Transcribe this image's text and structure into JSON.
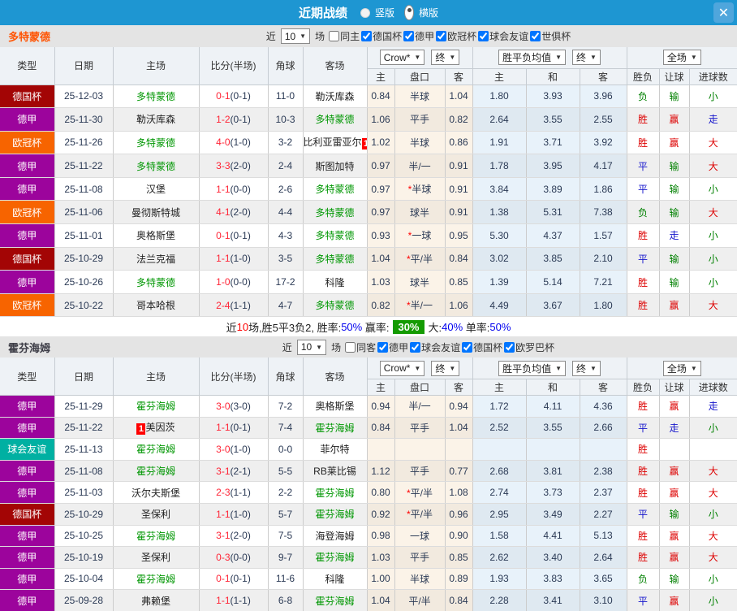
{
  "titlebar": {
    "title": "近期战绩",
    "radio_vertical": "竖版",
    "radio_horizontal": "横版",
    "close": "✕"
  },
  "colors": {
    "bar_blue": "#1e96d2",
    "score_red": "#ff2436",
    "team_green": "#009703",
    "result_red": "#dd0000",
    "result_green": "#008000",
    "result_blue": "#1515cc",
    "rate_blue": "#0000ee",
    "profit_box_green": "#149b02",
    "dortmund_orange": "#ff5505"
  },
  "league_colors": {
    "德国杯": "#a30505",
    "德甲": "#9c049c",
    "欧冠杯": "#f76400",
    "球会友谊": "#00b0a2"
  },
  "sections": [
    {
      "team": "多特蒙德",
      "filter": {
        "near": "近",
        "count": "10",
        "matches": "场",
        "same": {
          "label": "同主",
          "checked": false
        },
        "leagues": [
          {
            "label": "德国杯",
            "checked": true
          },
          {
            "label": "德甲",
            "checked": true
          },
          {
            "label": "欧冠杯",
            "checked": true
          },
          {
            "label": "球会友谊",
            "checked": true
          },
          {
            "label": "世俱杯",
            "checked": true
          }
        ]
      },
      "header": {
        "type": "类型",
        "date": "日期",
        "home": "主场",
        "score": "比分(半场)",
        "corner": "角球",
        "away": "客场",
        "odds_source": "Crow*",
        "odds_final": "终",
        "avg_source": "胜平负均值",
        "avg_final": "终",
        "scope": "全场",
        "odds_home": "主",
        "odds_handicap": "盘口",
        "odds_away": "客",
        "avg_home": "主",
        "avg_draw": "和",
        "avg_away": "客",
        "result": "胜负",
        "handicap_result": "让球",
        "goals_result": "进球数"
      },
      "rows": [
        {
          "league": "德国杯",
          "date": "25-12-03",
          "home": {
            "name": "多特蒙德",
            "green": true
          },
          "score": "0-1",
          "half": "0-1",
          "corner": "11-0",
          "away": {
            "name": "勒沃库森",
            "green": false
          },
          "odds": [
            "0.84",
            "半球",
            "1.04"
          ],
          "handicap_star": false,
          "avg": [
            "1.80",
            "3.93",
            "3.96"
          ],
          "results": [
            {
              "t": "负",
              "c": "green"
            },
            {
              "t": "输",
              "c": "green"
            },
            {
              "t": "小",
              "c": "green"
            }
          ]
        },
        {
          "league": "德甲",
          "date": "25-11-30",
          "home": {
            "name": "勒沃库森",
            "green": false
          },
          "score": "1-2",
          "half": "0-1",
          "corner": "10-3",
          "away": {
            "name": "多特蒙德",
            "green": true
          },
          "odds": [
            "1.06",
            "平手",
            "0.82"
          ],
          "handicap_star": false,
          "avg": [
            "2.64",
            "3.55",
            "2.55"
          ],
          "results": [
            {
              "t": "胜",
              "c": "red"
            },
            {
              "t": "赢",
              "c": "red"
            },
            {
              "t": "走",
              "c": "blue"
            }
          ]
        },
        {
          "league": "欧冠杯",
          "date": "25-11-26",
          "home": {
            "name": "多特蒙德",
            "green": true
          },
          "score": "4-0",
          "half": "1-0",
          "corner": "3-2",
          "away": {
            "name": "比利亚雷亚尔",
            "green": false,
            "badge": "1"
          },
          "odds": [
            "1.02",
            "半球",
            "0.86"
          ],
          "handicap_star": false,
          "avg": [
            "1.91",
            "3.71",
            "3.92"
          ],
          "results": [
            {
              "t": "胜",
              "c": "red"
            },
            {
              "t": "赢",
              "c": "red"
            },
            {
              "t": "大",
              "c": "red"
            }
          ]
        },
        {
          "league": "德甲",
          "date": "25-11-22",
          "home": {
            "name": "多特蒙德",
            "green": true
          },
          "score": "3-3",
          "half": "2-0",
          "corner": "2-4",
          "away": {
            "name": "斯图加特",
            "green": false
          },
          "odds": [
            "0.97",
            "半/一",
            "0.91"
          ],
          "handicap_star": false,
          "avg": [
            "1.78",
            "3.95",
            "4.17"
          ],
          "results": [
            {
              "t": "平",
              "c": "blue"
            },
            {
              "t": "输",
              "c": "green"
            },
            {
              "t": "大",
              "c": "red"
            }
          ]
        },
        {
          "league": "德甲",
          "date": "25-11-08",
          "home": {
            "name": "汉堡",
            "green": false
          },
          "score": "1-1",
          "half": "0-0",
          "corner": "2-6",
          "away": {
            "name": "多特蒙德",
            "green": true
          },
          "odds": [
            "0.97",
            "半球",
            "0.91"
          ],
          "handicap_star": true,
          "avg": [
            "3.84",
            "3.89",
            "1.86"
          ],
          "results": [
            {
              "t": "平",
              "c": "blue"
            },
            {
              "t": "输",
              "c": "green"
            },
            {
              "t": "小",
              "c": "green"
            }
          ]
        },
        {
          "league": "欧冠杯",
          "date": "25-11-06",
          "home": {
            "name": "曼彻斯特城",
            "green": false
          },
          "score": "4-1",
          "half": "2-0",
          "corner": "4-4",
          "away": {
            "name": "多特蒙德",
            "green": true
          },
          "odds": [
            "0.97",
            "球半",
            "0.91"
          ],
          "handicap_star": false,
          "avg": [
            "1.38",
            "5.31",
            "7.38"
          ],
          "results": [
            {
              "t": "负",
              "c": "green"
            },
            {
              "t": "输",
              "c": "green"
            },
            {
              "t": "大",
              "c": "red"
            }
          ]
        },
        {
          "league": "德甲",
          "date": "25-11-01",
          "home": {
            "name": "奥格斯堡",
            "green": false
          },
          "score": "0-1",
          "half": "0-1",
          "corner": "4-3",
          "away": {
            "name": "多特蒙德",
            "green": true
          },
          "odds": [
            "0.93",
            "一球",
            "0.95"
          ],
          "handicap_star": true,
          "avg": [
            "5.30",
            "4.37",
            "1.57"
          ],
          "results": [
            {
              "t": "胜",
              "c": "red"
            },
            {
              "t": "走",
              "c": "blue"
            },
            {
              "t": "小",
              "c": "green"
            }
          ]
        },
        {
          "league": "德国杯",
          "date": "25-10-29",
          "home": {
            "name": "法兰克福",
            "green": false
          },
          "score": "1-1",
          "half": "1-0",
          "corner": "3-5",
          "away": {
            "name": "多特蒙德",
            "green": true
          },
          "odds": [
            "1.04",
            "平/半",
            "0.84"
          ],
          "handicap_star": true,
          "avg": [
            "3.02",
            "3.85",
            "2.10"
          ],
          "results": [
            {
              "t": "平",
              "c": "blue"
            },
            {
              "t": "输",
              "c": "green"
            },
            {
              "t": "小",
              "c": "green"
            }
          ]
        },
        {
          "league": "德甲",
          "date": "25-10-26",
          "home": {
            "name": "多特蒙德",
            "green": true
          },
          "score": "1-0",
          "half": "0-0",
          "corner": "17-2",
          "away": {
            "name": "科隆",
            "green": false
          },
          "odds": [
            "1.03",
            "球半",
            "0.85"
          ],
          "handicap_star": false,
          "avg": [
            "1.39",
            "5.14",
            "7.21"
          ],
          "results": [
            {
              "t": "胜",
              "c": "red"
            },
            {
              "t": "输",
              "c": "green"
            },
            {
              "t": "小",
              "c": "green"
            }
          ]
        },
        {
          "league": "欧冠杯",
          "date": "25-10-22",
          "home": {
            "name": "哥本哈根",
            "green": false
          },
          "score": "2-4",
          "half": "1-1",
          "corner": "4-7",
          "away": {
            "name": "多特蒙德",
            "green": true
          },
          "odds": [
            "0.82",
            "半/一",
            "1.06"
          ],
          "handicap_star": true,
          "avg": [
            "4.49",
            "3.67",
            "1.80"
          ],
          "results": [
            {
              "t": "胜",
              "c": "red"
            },
            {
              "t": "赢",
              "c": "red"
            },
            {
              "t": "大",
              "c": "red"
            }
          ]
        }
      ],
      "summary": {
        "near": "近",
        "count": "10",
        "record": "场,胜5平3负2, 胜率:",
        "win_rate": "50%",
        "profit_label": " 赢率:",
        "profit_rate": "30%",
        "big_label": "大:",
        "big_rate": "40%",
        "single_label": " 单率:",
        "single_rate": "50%"
      }
    },
    {
      "team": "霍芬海姆",
      "filter": {
        "near": "近",
        "count": "10",
        "matches": "场",
        "same": {
          "label": "同客",
          "checked": false
        },
        "leagues": [
          {
            "label": "德甲",
            "checked": true
          },
          {
            "label": "球会友谊",
            "checked": true
          },
          {
            "label": "德国杯",
            "checked": true
          },
          {
            "label": "欧罗巴杯",
            "checked": true
          }
        ]
      },
      "header": {
        "type": "类型",
        "date": "日期",
        "home": "主场",
        "score": "比分(半场)",
        "corner": "角球",
        "away": "客场",
        "odds_source": "Crow*",
        "odds_final": "终",
        "avg_source": "胜平负均值",
        "avg_final": "终",
        "scope": "全场",
        "odds_home": "主",
        "odds_handicap": "盘口",
        "odds_away": "客",
        "avg_home": "主",
        "avg_draw": "和",
        "avg_away": "客",
        "result": "胜负",
        "handicap_result": "让球",
        "goals_result": "进球数"
      },
      "rows": [
        {
          "league": "德甲",
          "date": "25-11-29",
          "home": {
            "name": "霍芬海姆",
            "green": true
          },
          "score": "3-0",
          "half": "3-0",
          "corner": "7-2",
          "away": {
            "name": "奥格斯堡",
            "green": false
          },
          "odds": [
            "0.94",
            "半/一",
            "0.94"
          ],
          "handicap_star": false,
          "avg": [
            "1.72",
            "4.11",
            "4.36"
          ],
          "results": [
            {
              "t": "胜",
              "c": "red"
            },
            {
              "t": "赢",
              "c": "red"
            },
            {
              "t": "走",
              "c": "blue"
            }
          ]
        },
        {
          "league": "德甲",
          "date": "25-11-22",
          "home": {
            "name": "美因茨",
            "green": false,
            "badge": "1"
          },
          "score": "1-1",
          "half": "0-1",
          "corner": "7-4",
          "away": {
            "name": "霍芬海姆",
            "green": true
          },
          "odds": [
            "0.84",
            "平手",
            "1.04"
          ],
          "handicap_star": false,
          "avg": [
            "2.52",
            "3.55",
            "2.66"
          ],
          "results": [
            {
              "t": "平",
              "c": "blue"
            },
            {
              "t": "走",
              "c": "blue"
            },
            {
              "t": "小",
              "c": "green"
            }
          ]
        },
        {
          "league": "球会友谊",
          "date": "25-11-13",
          "home": {
            "name": "霍芬海姆",
            "green": true
          },
          "score": "3-0",
          "half": "1-0",
          "corner": "0-0",
          "away": {
            "name": "菲尔特",
            "green": false
          },
          "odds": [
            "",
            "",
            ""
          ],
          "handicap_star": false,
          "avg": [
            "",
            "",
            ""
          ],
          "results": [
            {
              "t": "胜",
              "c": "red"
            },
            {
              "t": "",
              "c": ""
            },
            {
              "t": "",
              "c": ""
            }
          ]
        },
        {
          "league": "德甲",
          "date": "25-11-08",
          "home": {
            "name": "霍芬海姆",
            "green": true
          },
          "score": "3-1",
          "half": "2-1",
          "corner": "5-5",
          "away": {
            "name": "RB莱比锡",
            "green": false
          },
          "odds": [
            "1.12",
            "平手",
            "0.77"
          ],
          "handicap_star": false,
          "avg": [
            "2.68",
            "3.81",
            "2.38"
          ],
          "results": [
            {
              "t": "胜",
              "c": "red"
            },
            {
              "t": "赢",
              "c": "red"
            },
            {
              "t": "大",
              "c": "red"
            }
          ]
        },
        {
          "league": "德甲",
          "date": "25-11-03",
          "home": {
            "name": "沃尔夫斯堡",
            "green": false
          },
          "score": "2-3",
          "half": "1-1",
          "corner": "2-2",
          "away": {
            "name": "霍芬海姆",
            "green": true
          },
          "odds": [
            "0.80",
            "平/半",
            "1.08"
          ],
          "handicap_star": true,
          "avg": [
            "2.74",
            "3.73",
            "2.37"
          ],
          "results": [
            {
              "t": "胜",
              "c": "red"
            },
            {
              "t": "赢",
              "c": "red"
            },
            {
              "t": "大",
              "c": "red"
            }
          ]
        },
        {
          "league": "德国杯",
          "date": "25-10-29",
          "home": {
            "name": "圣保利",
            "green": false
          },
          "score": "1-1",
          "half": "1-0",
          "corner": "5-7",
          "away": {
            "name": "霍芬海姆",
            "green": true
          },
          "odds": [
            "0.92",
            "平/半",
            "0.96"
          ],
          "handicap_star": true,
          "avg": [
            "2.95",
            "3.49",
            "2.27"
          ],
          "results": [
            {
              "t": "平",
              "c": "blue"
            },
            {
              "t": "输",
              "c": "green"
            },
            {
              "t": "小",
              "c": "green"
            }
          ]
        },
        {
          "league": "德甲",
          "date": "25-10-25",
          "home": {
            "name": "霍芬海姆",
            "green": true
          },
          "score": "3-1",
          "half": "2-0",
          "corner": "7-5",
          "away": {
            "name": "海登海姆",
            "green": false
          },
          "odds": [
            "0.98",
            "一球",
            "0.90"
          ],
          "handicap_star": false,
          "avg": [
            "1.58",
            "4.41",
            "5.13"
          ],
          "results": [
            {
              "t": "胜",
              "c": "red"
            },
            {
              "t": "赢",
              "c": "red"
            },
            {
              "t": "大",
              "c": "red"
            }
          ]
        },
        {
          "league": "德甲",
          "date": "25-10-19",
          "home": {
            "name": "圣保利",
            "green": false
          },
          "score": "0-3",
          "half": "0-0",
          "corner": "9-7",
          "away": {
            "name": "霍芬海姆",
            "green": true
          },
          "odds": [
            "1.03",
            "平手",
            "0.85"
          ],
          "handicap_star": false,
          "avg": [
            "2.62",
            "3.40",
            "2.64"
          ],
          "results": [
            {
              "t": "胜",
              "c": "red"
            },
            {
              "t": "赢",
              "c": "red"
            },
            {
              "t": "大",
              "c": "red"
            }
          ]
        },
        {
          "league": "德甲",
          "date": "25-10-04",
          "home": {
            "name": "霍芬海姆",
            "green": true
          },
          "score": "0-1",
          "half": "0-1",
          "corner": "11-6",
          "away": {
            "name": "科隆",
            "green": false
          },
          "odds": [
            "1.00",
            "半球",
            "0.89"
          ],
          "handicap_star": false,
          "avg": [
            "1.93",
            "3.83",
            "3.65"
          ],
          "results": [
            {
              "t": "负",
              "c": "green"
            },
            {
              "t": "输",
              "c": "green"
            },
            {
              "t": "小",
              "c": "green"
            }
          ]
        },
        {
          "league": "德甲",
          "date": "25-09-28",
          "home": {
            "name": "弗赖堡",
            "green": false
          },
          "score": "1-1",
          "half": "1-1",
          "corner": "6-8",
          "away": {
            "name": "霍芬海姆",
            "green": true
          },
          "odds": [
            "1.04",
            "平/半",
            "0.84"
          ],
          "handicap_star": false,
          "avg": [
            "2.28",
            "3.41",
            "3.10"
          ],
          "results": [
            {
              "t": "平",
              "c": "blue"
            },
            {
              "t": "赢",
              "c": "red"
            },
            {
              "t": "小",
              "c": "green"
            }
          ]
        }
      ],
      "summary": null
    }
  ]
}
